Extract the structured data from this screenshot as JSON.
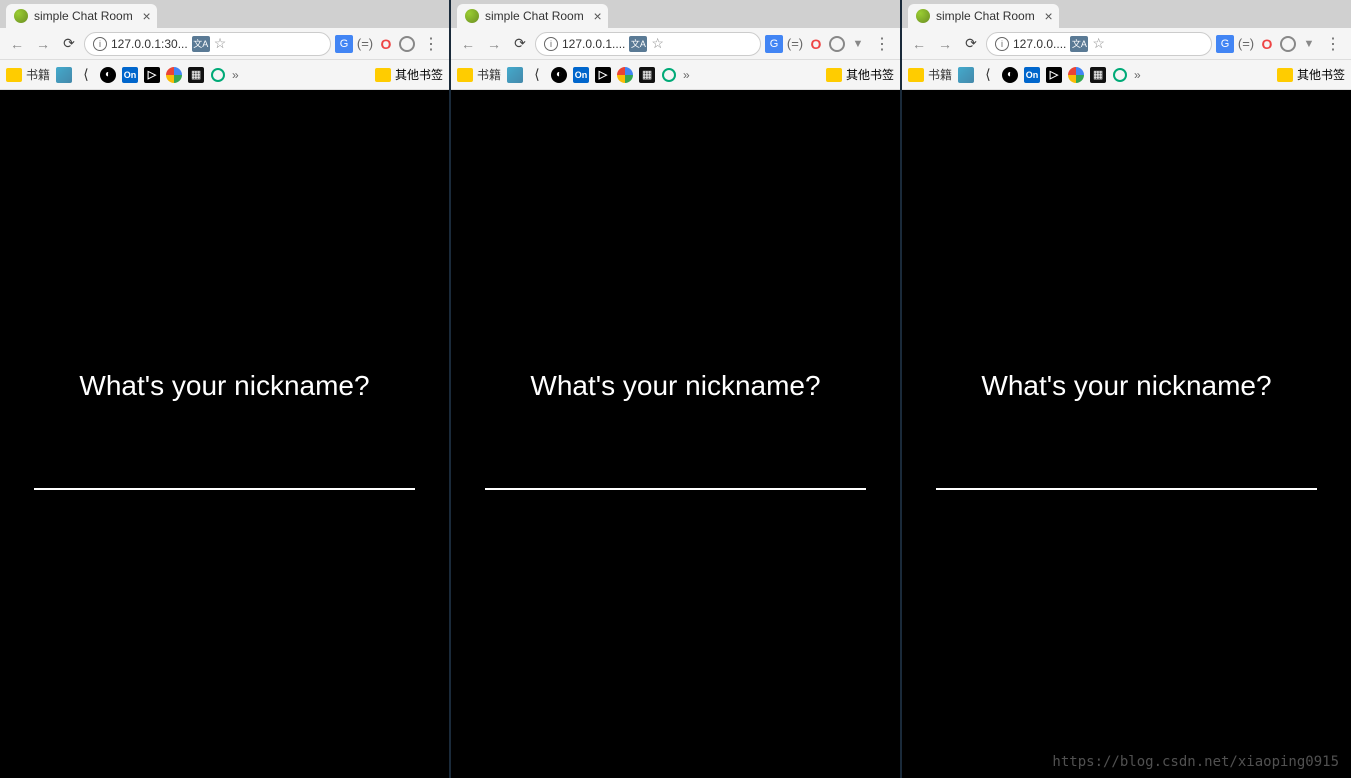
{
  "windows": [
    {
      "tab_title": "simple Chat Room",
      "url": "127.0.0.1:30...",
      "bookmarks_label": "书籍",
      "other_bookmarks": "其他书签",
      "prompt": "What's your nickname?",
      "input_value": ""
    },
    {
      "tab_title": "simple Chat Room",
      "url": "127.0.0.1....",
      "bookmarks_label": "书籍",
      "other_bookmarks": "其他书签",
      "prompt": "What's your nickname?",
      "input_value": ""
    },
    {
      "tab_title": "simple Chat Room",
      "url": "127.0.0....",
      "bookmarks_label": "书籍",
      "other_bookmarks": "其他书签",
      "prompt": "What's your nickname?",
      "input_value": ""
    }
  ],
  "watermark": "https://blog.csdn.net/xiaoping0915"
}
